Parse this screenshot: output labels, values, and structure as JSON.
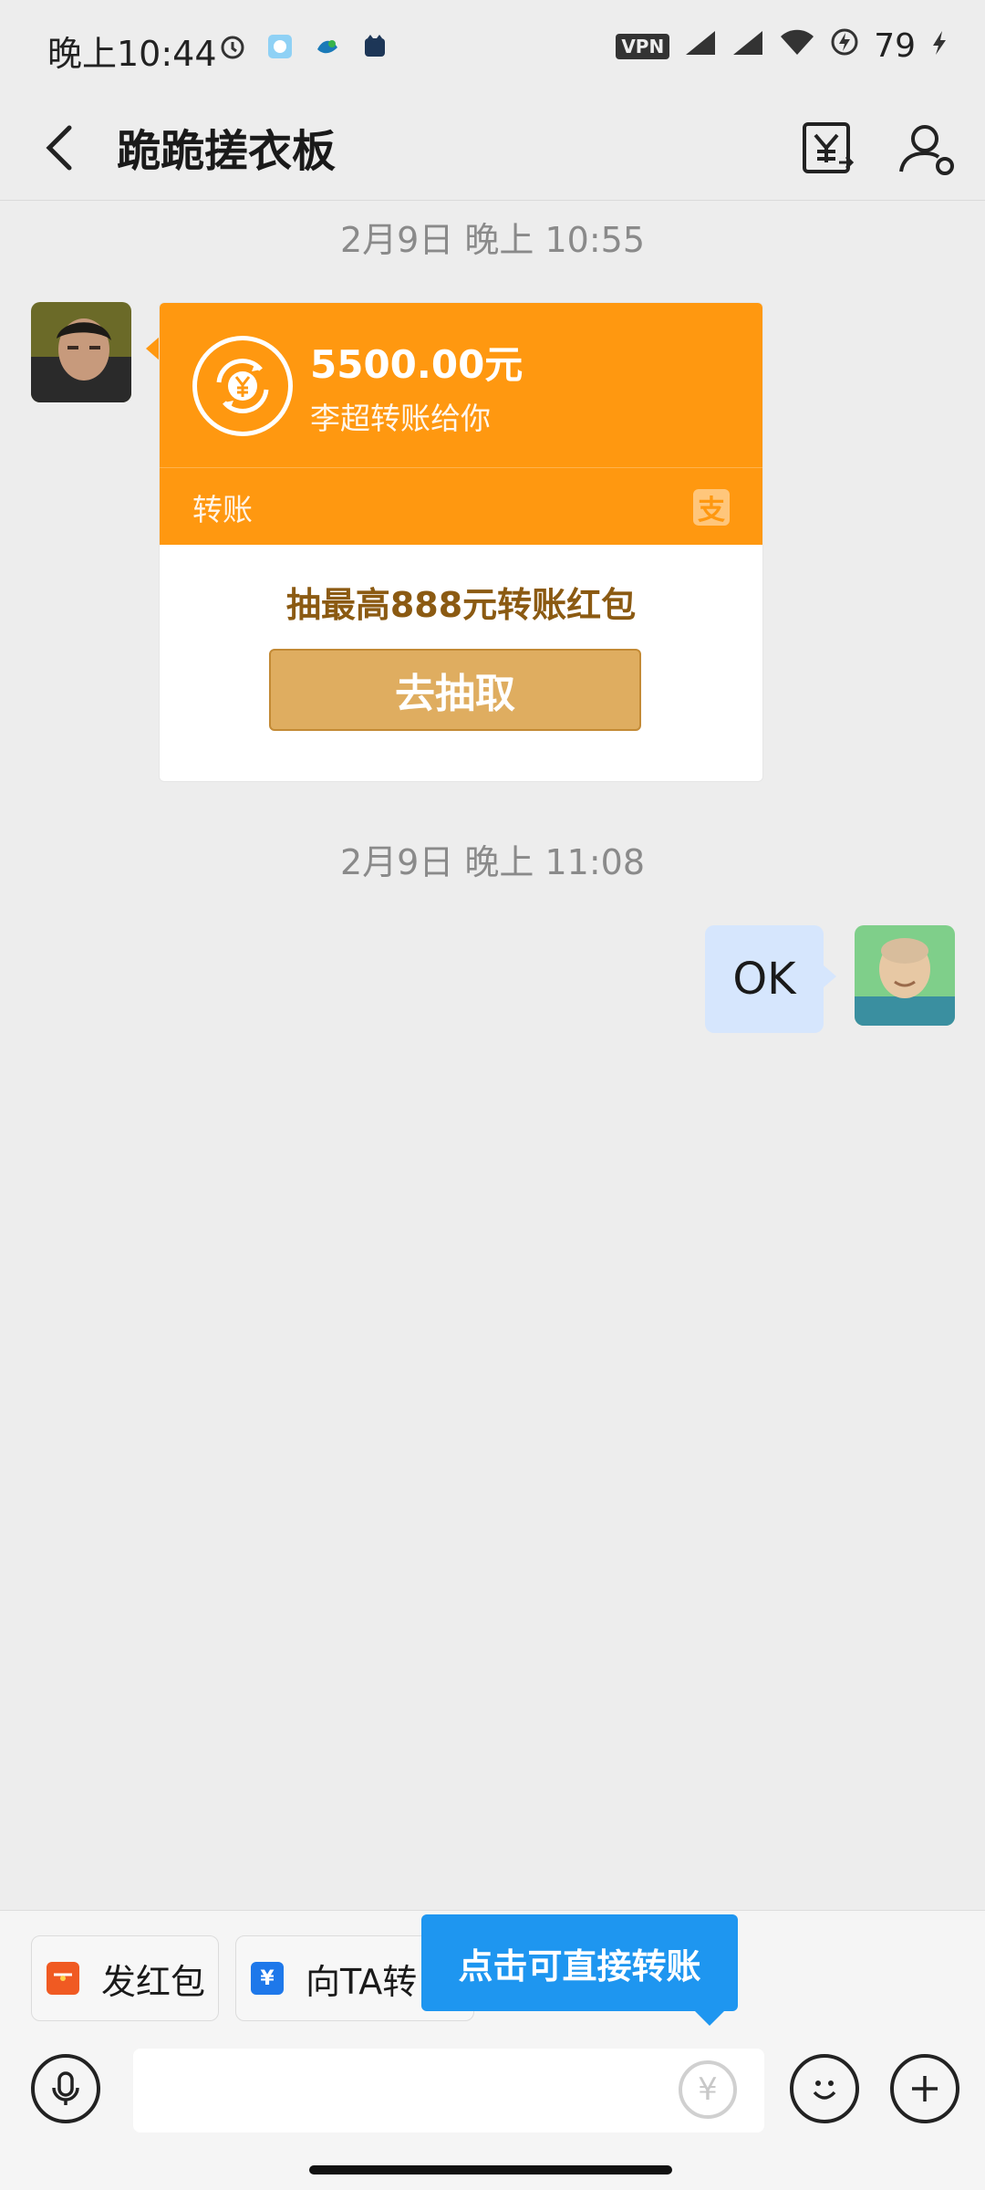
{
  "status_bar": {
    "time": "晚上10:44",
    "vpn": "VPN",
    "battery": "79"
  },
  "header": {
    "title": "跪跪搓衣板"
  },
  "chat": {
    "timestamp_1": "2月9日 晚上 10:55",
    "transfer": {
      "amount": "5500.00元",
      "payer": "李超转账给你",
      "label": "转账",
      "alipay_glyph": "支",
      "promo": "抽最高888元转账红包",
      "button": "去抽取"
    },
    "timestamp_2": "2月9日 晚上 11:08",
    "outgoing_message": "OK"
  },
  "bottom": {
    "chip_redpacket": "发红包",
    "chip_transfer": "向TA转",
    "tooltip": "点击可直接转账",
    "input_placeholder": ""
  },
  "colors": {
    "transfer_orange": "#ff9810",
    "button_gold": "#dfad60",
    "bubble_blue": "#d6e6fd",
    "tooltip_blue": "#1e96f0"
  },
  "icons": [
    "alarm-icon",
    "app-icon",
    "app-icon",
    "app-icon",
    "signal-icon",
    "wifi-icon",
    "charging-icon",
    "back-icon",
    "transfer-icon",
    "contact-settings-icon",
    "yen-icon",
    "microphone-icon",
    "emoji-icon",
    "plus-icon"
  ]
}
